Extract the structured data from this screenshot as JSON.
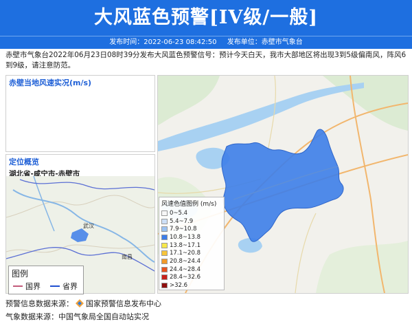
{
  "header": {
    "title": "大风蓝色预警[IV级/一般]",
    "publish_time_label": "发布时间：2022-06-23 08:42:50",
    "publisher_label": "发布单位：赤壁市气象台"
  },
  "description": "赤壁市气象台2022年06月23日08时39分发布大风蓝色预警信号：预计今天白天，我市大部地区将出现3到5级偏南风，阵风6到9级，请注意防范。",
  "wind_panel": {
    "title": "赤壁当地风速实况(m/s)"
  },
  "location_panel": {
    "title": "定位概览",
    "location": "湖北省-咸宁市-赤壁市"
  },
  "map_labels": {
    "wuhan": "武汉",
    "nanchang": "南昌"
  },
  "legend": {
    "title": "风速色值图例 (m/s)",
    "items": [
      {
        "label": "0~5.4",
        "color": "#f7f7f7"
      },
      {
        "label": "5.4~7.9",
        "color": "#cde0f7"
      },
      {
        "label": "7.9~10.8",
        "color": "#9cc3f2"
      },
      {
        "label": "10.8~13.8",
        "color": "#3d7ee9"
      },
      {
        "label": "13.8~17.1",
        "color": "#f7e84a"
      },
      {
        "label": "17.1~20.8",
        "color": "#f7c43a"
      },
      {
        "label": "20.8~24.4",
        "color": "#f29a2a"
      },
      {
        "label": "24.4~28.4",
        "color": "#e8531f"
      },
      {
        "label": "28.4~32.6",
        "color": "#c8201a"
      },
      {
        "label": ">32.6",
        "color": "#8f0f0f"
      }
    ]
  },
  "mini_legend": {
    "title": "图例",
    "items": [
      {
        "label": "国界",
        "color": "#c25a7a"
      },
      {
        "label": "省界",
        "color": "#1f4fd0"
      }
    ]
  },
  "footer": {
    "warning_source": "预警信息数据来源：",
    "warning_source_name": "国家预警信息发布中心",
    "weather_source": "气象数据来源：中国气象局全国自动站实况"
  },
  "colors": {
    "primary": "#1e6fe0",
    "warning_area": "#3d7ee9"
  }
}
